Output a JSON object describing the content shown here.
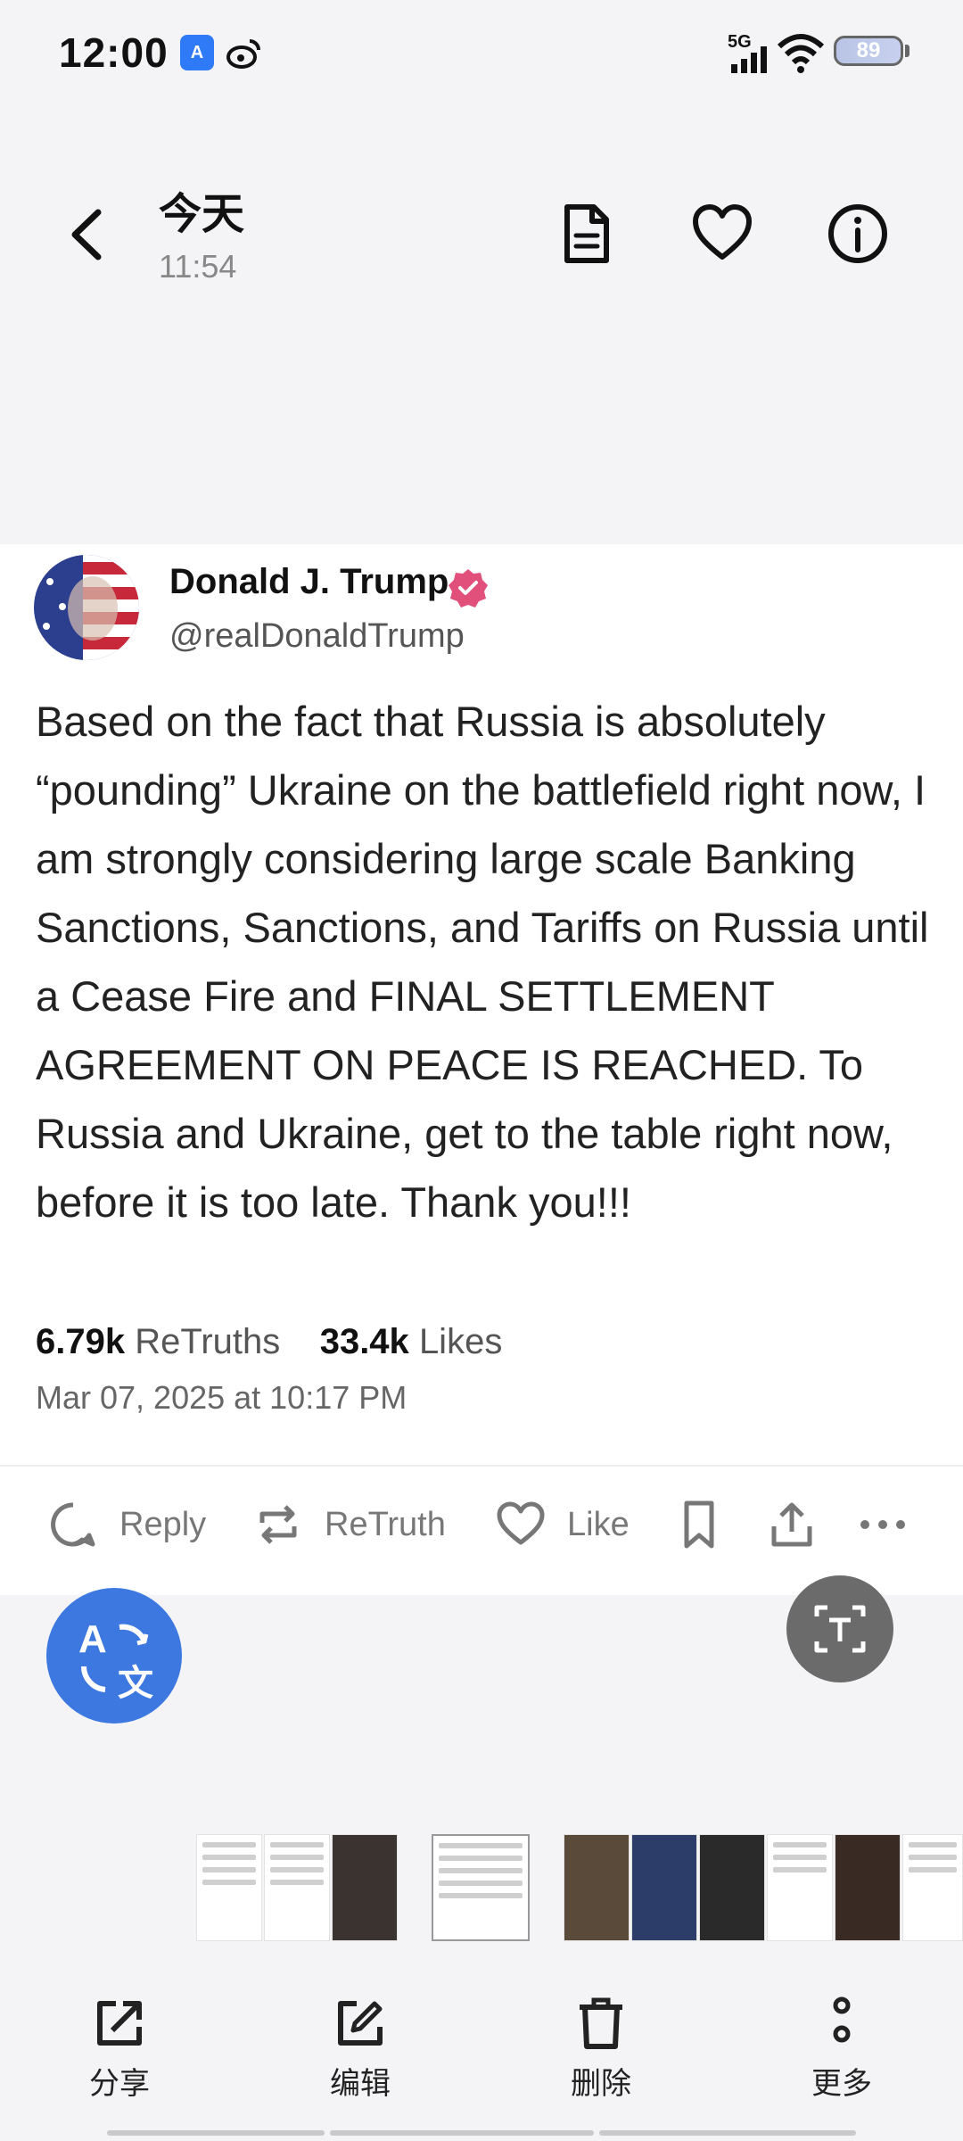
{
  "status_bar": {
    "time": "12:00",
    "network": "5G",
    "battery": "89"
  },
  "header": {
    "title": "今天",
    "subtitle": "11:54",
    "icons": [
      "document-icon",
      "heart-icon",
      "info-icon"
    ]
  },
  "post": {
    "author_name": "Donald J. Trump",
    "handle": "@realDonaldTrump",
    "text": "Based on the fact that Russia is absolutely “pounding” Ukraine on the battlefield right now, I am strongly considering large scale Banking Sanctions, Sanctions, and Tariffs on Russia until a Cease Fire and FINAL SETTLEMENT AGREEMENT ON PEACE IS REACHED. To Russia and Ukraine, get to the table right now, before it is too late. Thank you!!!",
    "retruths_count": "6.79k",
    "retruths_label": "ReTruths",
    "likes_count": "33.4k",
    "likes_label": "Likes",
    "timestamp": "Mar 07, 2025 at 10:17 PM",
    "actions": {
      "reply": "Reply",
      "retruth": "ReTruth",
      "like": "Like"
    }
  },
  "toolbar": {
    "share": "分享",
    "edit": "编辑",
    "delete": "删除",
    "more": "更多"
  },
  "colors": {
    "accent_blue": "#3c78e0",
    "verified_pink": "#e0507a",
    "background": "#f4f4f6"
  }
}
